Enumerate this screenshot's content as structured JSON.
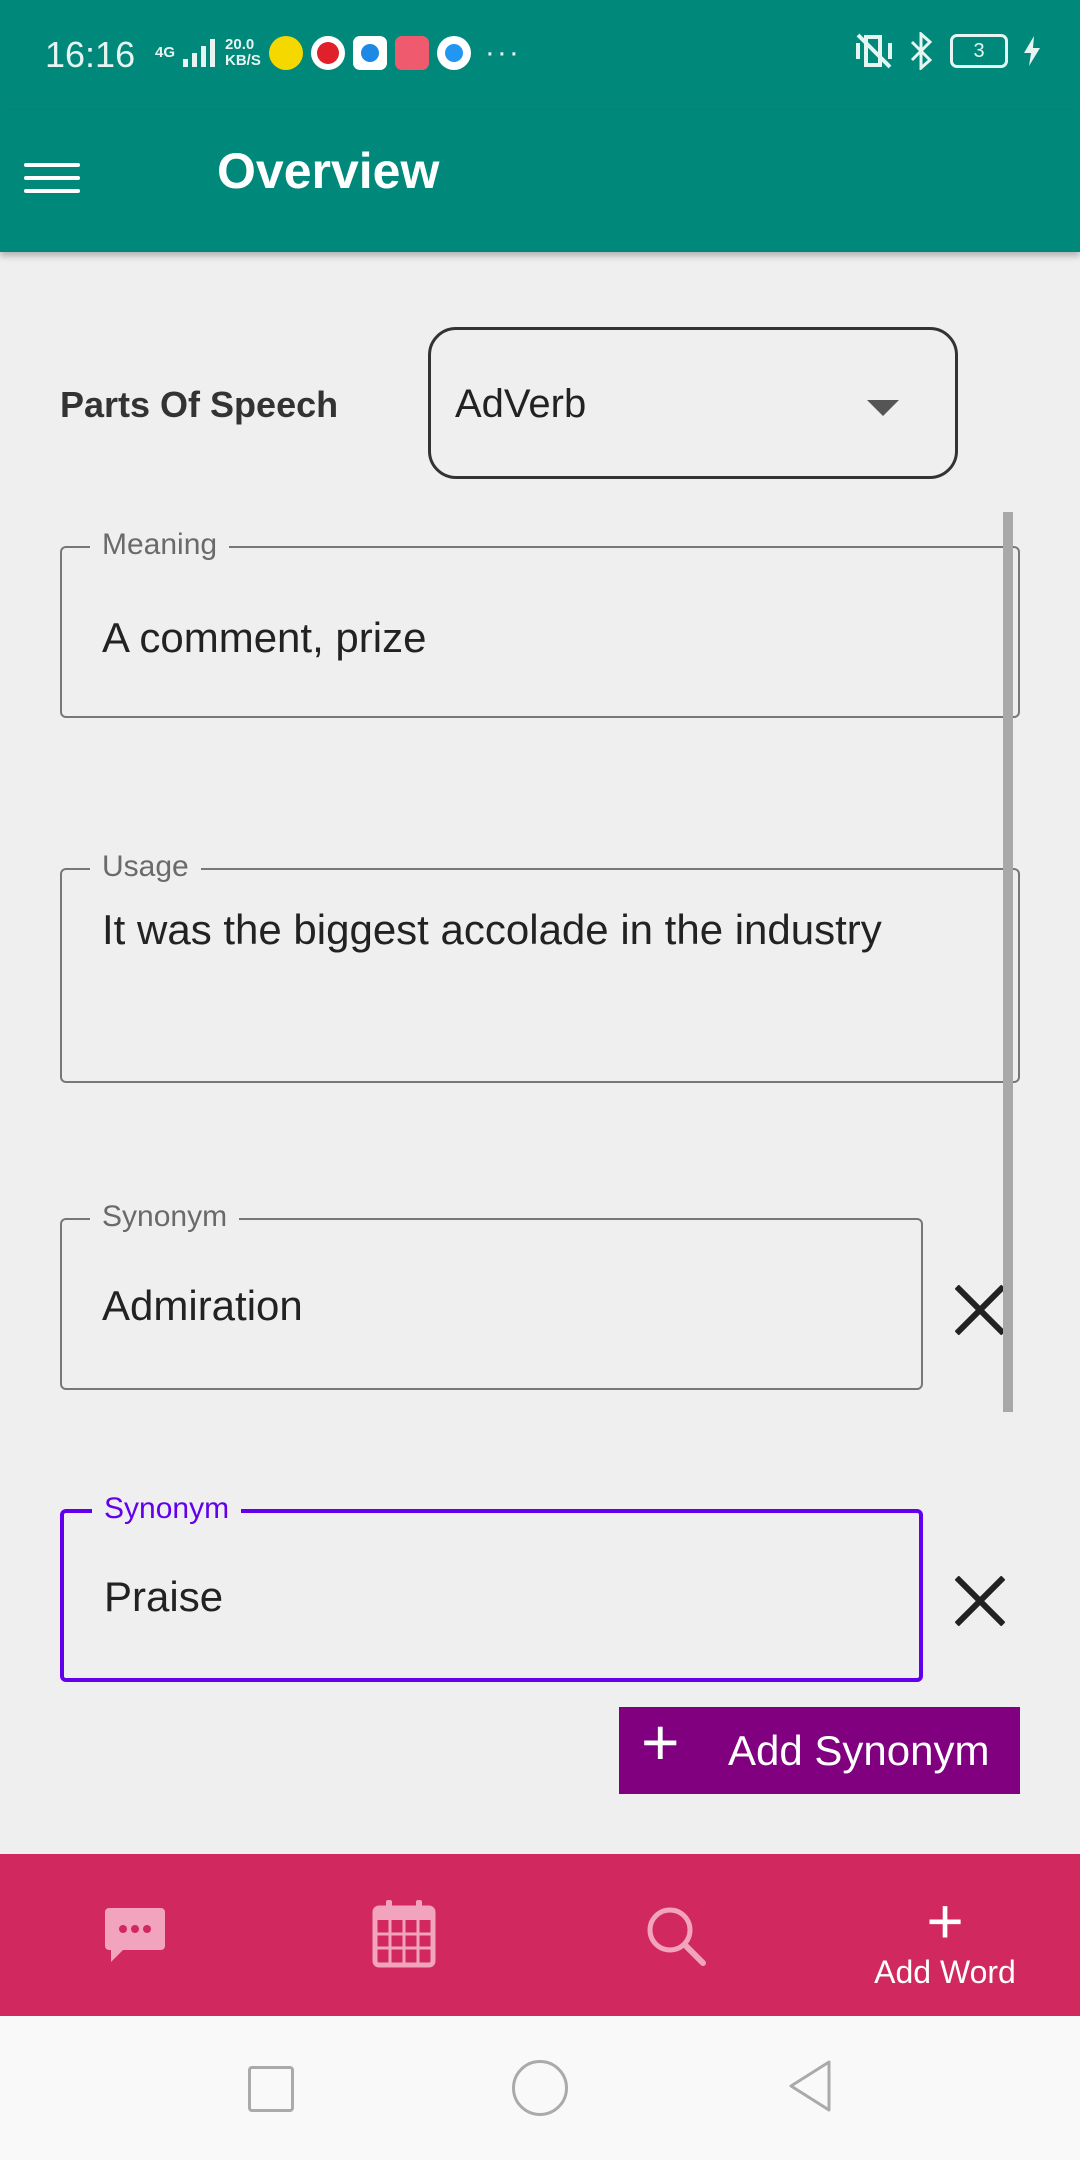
{
  "status_bar": {
    "time": "16:16",
    "network_type": "4G",
    "speed_value": "20.0",
    "speed_unit": "KB/S",
    "battery_level": "3",
    "more_indicator": "···"
  },
  "app_bar": {
    "title": "Overview",
    "menu_icon": "hamburger-menu-icon"
  },
  "form": {
    "parts_of_speech_label": "Parts Of Speech",
    "parts_of_speech_value": "AdVerb",
    "meaning": {
      "label": "Meaning",
      "value": "A comment, prize"
    },
    "usage": {
      "label": "Usage",
      "value": "It was the biggest accolade in the industry"
    },
    "synonyms": [
      {
        "label": "Synonym",
        "value": "Admiration"
      },
      {
        "label": "Synonym",
        "value": "Praise"
      }
    ],
    "add_synonym_label": "Add Synonym"
  },
  "bottom_nav": {
    "items": [
      {
        "icon": "chat-bubble-icon"
      },
      {
        "icon": "calendar-icon"
      },
      {
        "icon": "search-icon"
      },
      {
        "icon": "plus-icon",
        "label": "Add Word"
      }
    ]
  },
  "colors": {
    "primary": "#00897b",
    "accent_nav": "#d0285f",
    "add_button": "#800080",
    "focus": "#6200ee"
  }
}
